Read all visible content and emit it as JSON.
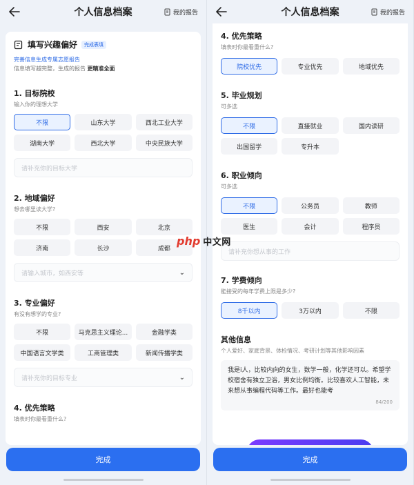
{
  "header": {
    "title": "个人信息档案",
    "report_label": "我的报告"
  },
  "left": {
    "intro": {
      "title": "填写兴趣偏好",
      "badge": "完成表填",
      "line1": "完善信息生成专属志愿报告",
      "line2_prefix": "信息填写越完整，生成的报告",
      "line2_bold": "更精准全面"
    },
    "school": {
      "title": "1. 目标院校",
      "subtitle": "输入你的理想大学",
      "options": [
        "不限",
        "山东大学",
        "西北工业大学",
        "湖南大学",
        "西北大学",
        "中央民族大学"
      ],
      "input_placeholder": "请补充你的目标大学"
    },
    "region": {
      "title": "2. 地域偏好",
      "subtitle": "想去哪里读大学?",
      "options": [
        "不限",
        "西安",
        "北京",
        "济南",
        "长沙",
        "成都"
      ],
      "input_placeholder": "请输入城市，如西安等"
    },
    "major": {
      "title": "3. 专业偏好",
      "subtitle": "有没有想学的专业?",
      "options": [
        "不限",
        "马克思主义理论...",
        "金融学类",
        "中国语言文学类",
        "工商管理类",
        "新闻传播学类"
      ],
      "input_placeholder": "请补充你的目标专业"
    },
    "strategy": {
      "title": "4. 优先策略",
      "subtitle": "填表时你最看重什么?"
    }
  },
  "right": {
    "strategy": {
      "title": "4. 优先策略",
      "subtitle": "填表时你最看重什么?",
      "options": [
        "院校优先",
        "专业优先",
        "地域优先"
      ]
    },
    "career": {
      "title": "5. 毕业规划",
      "subtitle": "可多选",
      "options": [
        "不限",
        "直接就业",
        "国内读研",
        "出国留学",
        "专升本"
      ]
    },
    "job": {
      "title": "6. 职业倾向",
      "subtitle": "可多选",
      "options": [
        "不限",
        "公务员",
        "教师",
        "医生",
        "会计",
        "程序员"
      ],
      "input_placeholder": "请补充你想从事的工作"
    },
    "tuition": {
      "title": "7. 学费倾向",
      "subtitle": "能接受的每年学费上限是多少?",
      "options": [
        "8千以内",
        "3万以内",
        "不限"
      ]
    },
    "other": {
      "title": "其他信息",
      "subtitle": "个人爱好、家庭背景、体检情况、考研计划等其他影响因素",
      "text": "我是i人，比较内向的女生，数学一般，化学还可以。希望学校宿舍有独立卫浴，男女比例均衡。比较喜欢人工智能，未来想从事编程代码等工作。最好也能考",
      "count": "84/200"
    }
  },
  "footer": {
    "done_label": "完成"
  },
  "watermark": {
    "logo": "php",
    "text": "中文网"
  }
}
